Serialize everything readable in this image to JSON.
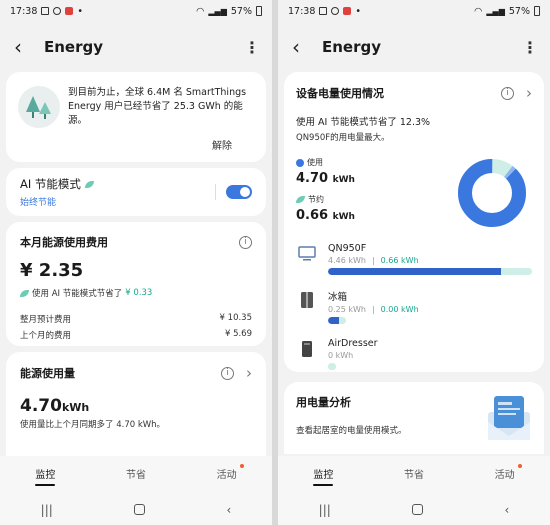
{
  "status": {
    "time": "17:38",
    "battery": "57%"
  },
  "left": {
    "title": "Energy",
    "promo": {
      "text": "到目前为止，全球 6.4M 名 SmartThings Energy 用户已经节省了 25.3 GWh 的能源。",
      "dismiss": "解除"
    },
    "ai_mode": {
      "title": "AI 节能模式",
      "subtitle": "始终节能",
      "toggle_on": true
    },
    "cost": {
      "title": "本月能源使用费用",
      "amount": "¥ 2.35",
      "saved_prefix": "使用 AI 节能模式节省了",
      "saved_amount": "¥ 0.33",
      "rows": [
        {
          "label": "整月预计费用",
          "value": "¥ 10.35"
        },
        {
          "label": "上个月的费用",
          "value": "¥ 5.69"
        }
      ]
    },
    "usage": {
      "title": "能源使用量",
      "value": "4.70",
      "unit": "kWh",
      "note": "使用量比上个月同期多了 4.70 kWh。"
    },
    "nav": {
      "tab1": "监控",
      "tab2": "节省",
      "tab3": "活动"
    }
  },
  "right": {
    "title": "Energy",
    "device_usage": {
      "title": "设备电量使用情况",
      "ai_saved": "使用 AI 节能模式节省了 12.3%",
      "top_device": "QN950F的用电量最大。",
      "used_label": "使用",
      "used_value": "4.70",
      "used_unit": "kWh",
      "saved_label": "节约",
      "saved_value": "0.66",
      "saved_unit": "kWh",
      "donut": {
        "used_fraction": 0.877,
        "saved_fraction": 0.123,
        "colors": {
          "used": "#3a78e0",
          "saved": "#cfeee7",
          "accent": "#8fb8f0"
        }
      },
      "devices": [
        {
          "name": "QN950F",
          "usage": "4.46 kWh",
          "saved": "0.66 kWh",
          "usage_fraction": 0.85,
          "saved_fraction": 0.15
        },
        {
          "name": "冰箱",
          "usage": "0.25 kWh",
          "saved": "0.00 kWh",
          "usage_fraction": 0.05,
          "saved_fraction": 0.03
        },
        {
          "name": "AirDresser",
          "usage": "0 kWh",
          "saved": "",
          "usage_fraction": 0.0,
          "saved_fraction": 0.0
        }
      ]
    },
    "analysis": {
      "title": "用电量分析",
      "subtitle": "查看起居室的电量使用模式。"
    },
    "nav": {
      "tab1": "监控",
      "tab2": "节省",
      "tab3": "活动"
    }
  }
}
